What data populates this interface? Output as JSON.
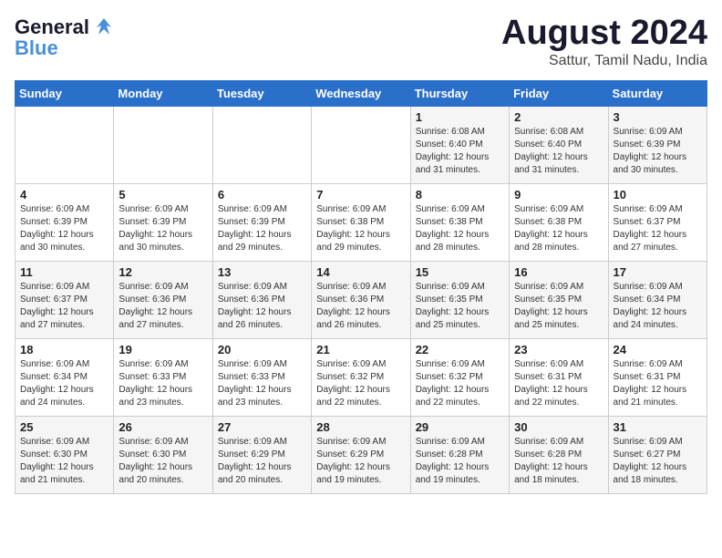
{
  "logo": {
    "line1": "General",
    "line2": "Blue"
  },
  "title": "August 2024",
  "subtitle": "Sattur, Tamil Nadu, India",
  "days_of_week": [
    "Sunday",
    "Monday",
    "Tuesday",
    "Wednesday",
    "Thursday",
    "Friday",
    "Saturday"
  ],
  "weeks": [
    [
      {
        "day": "",
        "info": ""
      },
      {
        "day": "",
        "info": ""
      },
      {
        "day": "",
        "info": ""
      },
      {
        "day": "",
        "info": ""
      },
      {
        "day": "1",
        "info": "Sunrise: 6:08 AM\nSunset: 6:40 PM\nDaylight: 12 hours\nand 31 minutes."
      },
      {
        "day": "2",
        "info": "Sunrise: 6:08 AM\nSunset: 6:40 PM\nDaylight: 12 hours\nand 31 minutes."
      },
      {
        "day": "3",
        "info": "Sunrise: 6:09 AM\nSunset: 6:39 PM\nDaylight: 12 hours\nand 30 minutes."
      }
    ],
    [
      {
        "day": "4",
        "info": "Sunrise: 6:09 AM\nSunset: 6:39 PM\nDaylight: 12 hours\nand 30 minutes."
      },
      {
        "day": "5",
        "info": "Sunrise: 6:09 AM\nSunset: 6:39 PM\nDaylight: 12 hours\nand 30 minutes."
      },
      {
        "day": "6",
        "info": "Sunrise: 6:09 AM\nSunset: 6:39 PM\nDaylight: 12 hours\nand 29 minutes."
      },
      {
        "day": "7",
        "info": "Sunrise: 6:09 AM\nSunset: 6:38 PM\nDaylight: 12 hours\nand 29 minutes."
      },
      {
        "day": "8",
        "info": "Sunrise: 6:09 AM\nSunset: 6:38 PM\nDaylight: 12 hours\nand 28 minutes."
      },
      {
        "day": "9",
        "info": "Sunrise: 6:09 AM\nSunset: 6:38 PM\nDaylight: 12 hours\nand 28 minutes."
      },
      {
        "day": "10",
        "info": "Sunrise: 6:09 AM\nSunset: 6:37 PM\nDaylight: 12 hours\nand 27 minutes."
      }
    ],
    [
      {
        "day": "11",
        "info": "Sunrise: 6:09 AM\nSunset: 6:37 PM\nDaylight: 12 hours\nand 27 minutes."
      },
      {
        "day": "12",
        "info": "Sunrise: 6:09 AM\nSunset: 6:36 PM\nDaylight: 12 hours\nand 27 minutes."
      },
      {
        "day": "13",
        "info": "Sunrise: 6:09 AM\nSunset: 6:36 PM\nDaylight: 12 hours\nand 26 minutes."
      },
      {
        "day": "14",
        "info": "Sunrise: 6:09 AM\nSunset: 6:36 PM\nDaylight: 12 hours\nand 26 minutes."
      },
      {
        "day": "15",
        "info": "Sunrise: 6:09 AM\nSunset: 6:35 PM\nDaylight: 12 hours\nand 25 minutes."
      },
      {
        "day": "16",
        "info": "Sunrise: 6:09 AM\nSunset: 6:35 PM\nDaylight: 12 hours\nand 25 minutes."
      },
      {
        "day": "17",
        "info": "Sunrise: 6:09 AM\nSunset: 6:34 PM\nDaylight: 12 hours\nand 24 minutes."
      }
    ],
    [
      {
        "day": "18",
        "info": "Sunrise: 6:09 AM\nSunset: 6:34 PM\nDaylight: 12 hours\nand 24 minutes."
      },
      {
        "day": "19",
        "info": "Sunrise: 6:09 AM\nSunset: 6:33 PM\nDaylight: 12 hours\nand 23 minutes."
      },
      {
        "day": "20",
        "info": "Sunrise: 6:09 AM\nSunset: 6:33 PM\nDaylight: 12 hours\nand 23 minutes."
      },
      {
        "day": "21",
        "info": "Sunrise: 6:09 AM\nSunset: 6:32 PM\nDaylight: 12 hours\nand 22 minutes."
      },
      {
        "day": "22",
        "info": "Sunrise: 6:09 AM\nSunset: 6:32 PM\nDaylight: 12 hours\nand 22 minutes."
      },
      {
        "day": "23",
        "info": "Sunrise: 6:09 AM\nSunset: 6:31 PM\nDaylight: 12 hours\nand 22 minutes."
      },
      {
        "day": "24",
        "info": "Sunrise: 6:09 AM\nSunset: 6:31 PM\nDaylight: 12 hours\nand 21 minutes."
      }
    ],
    [
      {
        "day": "25",
        "info": "Sunrise: 6:09 AM\nSunset: 6:30 PM\nDaylight: 12 hours\nand 21 minutes."
      },
      {
        "day": "26",
        "info": "Sunrise: 6:09 AM\nSunset: 6:30 PM\nDaylight: 12 hours\nand 20 minutes."
      },
      {
        "day": "27",
        "info": "Sunrise: 6:09 AM\nSunset: 6:29 PM\nDaylight: 12 hours\nand 20 minutes."
      },
      {
        "day": "28",
        "info": "Sunrise: 6:09 AM\nSunset: 6:29 PM\nDaylight: 12 hours\nand 19 minutes."
      },
      {
        "day": "29",
        "info": "Sunrise: 6:09 AM\nSunset: 6:28 PM\nDaylight: 12 hours\nand 19 minutes."
      },
      {
        "day": "30",
        "info": "Sunrise: 6:09 AM\nSunset: 6:28 PM\nDaylight: 12 hours\nand 18 minutes."
      },
      {
        "day": "31",
        "info": "Sunrise: 6:09 AM\nSunset: 6:27 PM\nDaylight: 12 hours\nand 18 minutes."
      }
    ]
  ]
}
